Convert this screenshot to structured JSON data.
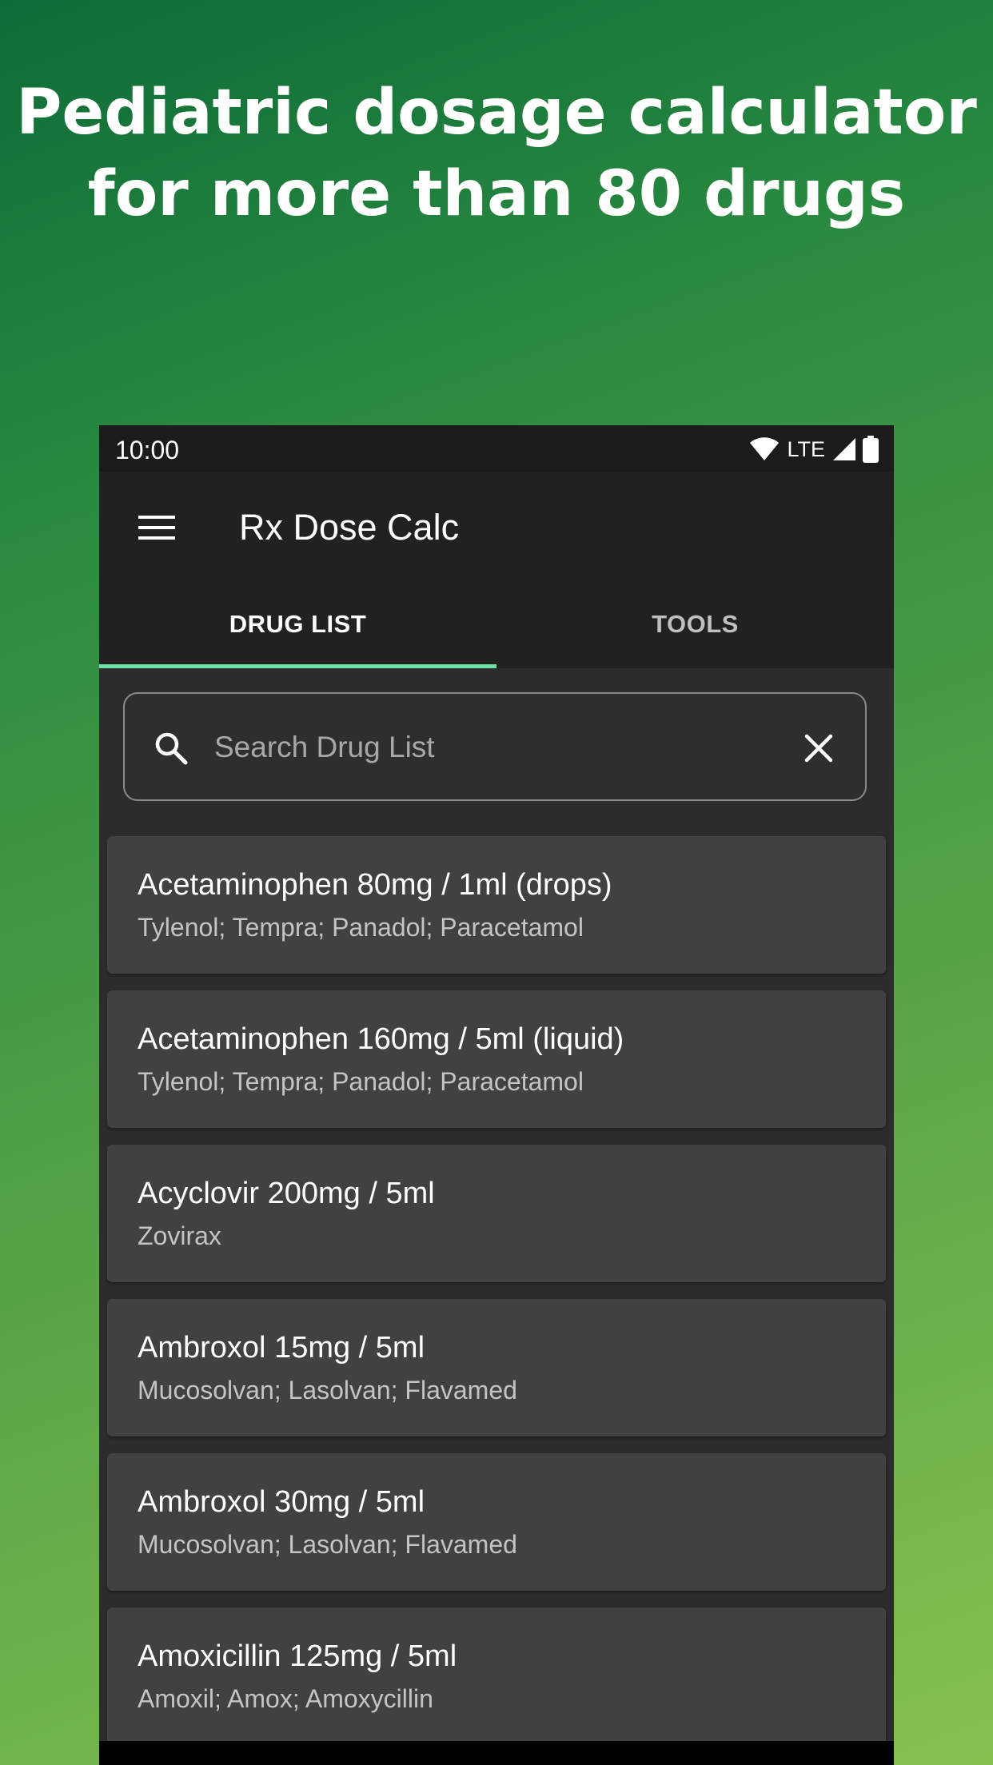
{
  "headline": {
    "line1": "Pediatric dosage calculator",
    "line2": "for more than 80 drugs"
  },
  "status_bar": {
    "time": "10:00",
    "network": "LTE",
    "icons": [
      "wifi-icon",
      "signal-icon",
      "battery-icon"
    ]
  },
  "toolbar": {
    "menu_icon": "hamburger-menu-icon",
    "title": "Rx Dose Calc"
  },
  "tabs": [
    {
      "label": "DRUG LIST",
      "active": true
    },
    {
      "label": "TOOLS",
      "active": false
    }
  ],
  "search": {
    "placeholder": "Search Drug List",
    "value": "",
    "search_icon": "search-icon",
    "clear_icon": "close-icon"
  },
  "drugs": [
    {
      "name": "Acetaminophen 80mg / 1ml (drops)",
      "brands": "Tylenol; Tempra; Panadol; Paracetamol"
    },
    {
      "name": "Acetaminophen 160mg / 5ml (liquid)",
      "brands": "Tylenol; Tempra; Panadol; Paracetamol"
    },
    {
      "name": "Acyclovir 200mg / 5ml",
      "brands": "Zovirax"
    },
    {
      "name": "Ambroxol 15mg / 5ml",
      "brands": "Mucosolvan; Lasolvan; Flavamed"
    },
    {
      "name": "Ambroxol 30mg / 5ml",
      "brands": "Mucosolvan; Lasolvan; Flavamed"
    },
    {
      "name": "Amoxicillin 125mg / 5ml",
      "brands": "Amoxil; Amox; Amoxycillin"
    }
  ],
  "colors": {
    "background_top": "#0e6b38",
    "background_bottom": "#86c150",
    "toolbar": "#212121",
    "card": "#414141",
    "tab_indicator": "#6ee0a8"
  }
}
